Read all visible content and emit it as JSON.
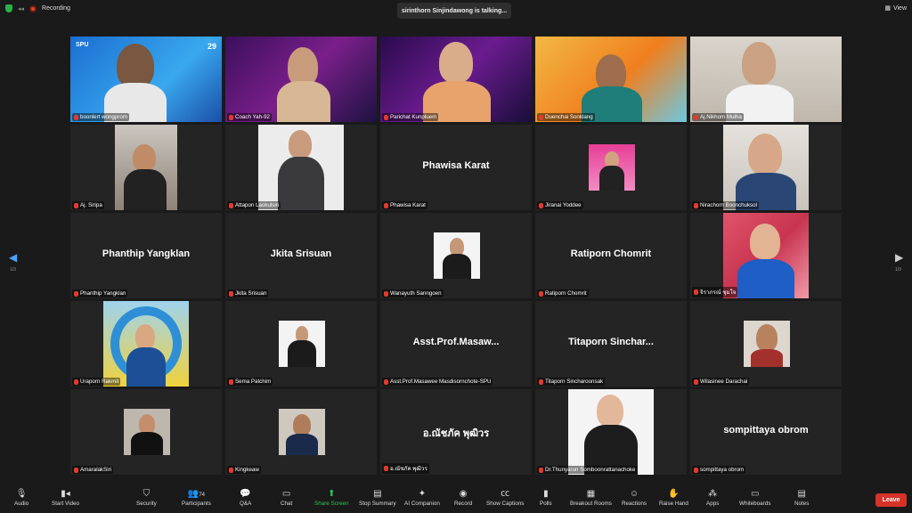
{
  "topbar": {
    "recording_label": "Recording",
    "talking_text": "sirinthorn Sinjindawong is talking...",
    "view_label": "View"
  },
  "navigation": {
    "left_page": "1/3",
    "right_page": "1/3"
  },
  "tiles": [
    {
      "label": "boonlert wongprom",
      "big": ""
    },
    {
      "label": "Coach Yah-92",
      "big": ""
    },
    {
      "label": "Parichat Kunpluem",
      "big": ""
    },
    {
      "label": "Duenchai Sonklang",
      "big": ""
    },
    {
      "label": "Aj.Nikhom Mulha",
      "big": ""
    },
    {
      "label": "Aj. Siripa",
      "big": ""
    },
    {
      "label": "Attapon Laokulsiri",
      "big": ""
    },
    {
      "label": "Phawisa Karat",
      "big": "Phawisa Karat"
    },
    {
      "label": "Jiranai Yoddee",
      "big": ""
    },
    {
      "label": "Nirachorn Boonchuksol",
      "big": ""
    },
    {
      "label": "Phanthip Yangklan",
      "big": "Phanthip Yangklan"
    },
    {
      "label": "Jkita Srisuan",
      "big": "Jkita Srisuan"
    },
    {
      "label": "Wanayuth Sanngoen",
      "big": ""
    },
    {
      "label": "Ratiporn Chomrit",
      "big": "Ratiporn Chomrit"
    },
    {
      "label": "จิราภรณ์ ชุมใจ",
      "big": ""
    },
    {
      "label": "Uraporn Rakmit",
      "big": ""
    },
    {
      "label": "Sema Patchim",
      "big": ""
    },
    {
      "label": "Asst.Prof.Masawee Masdisornchote-SPU",
      "big": "Asst.Prof.Masaw..."
    },
    {
      "label": "Titaporn Sincharoonsak",
      "big": "Titaporn  Sinchar..."
    },
    {
      "label": "Wilasinee Darachai",
      "big": ""
    },
    {
      "label": "AmaralakSiri",
      "big": ""
    },
    {
      "label": "Kingkeaw",
      "big": ""
    },
    {
      "label": "อ.ณัชภัค พุฒิวร",
      "big": "อ.ณัชภัค พุฒิวร"
    },
    {
      "label": "Dr.Thunyarun Somboonrattanachoke",
      "big": ""
    },
    {
      "label": "sompittaya obrom",
      "big": "sompittaya obrom"
    }
  ],
  "toolbar": {
    "audio": "Audio",
    "start_video": "Start Video",
    "security": "Security",
    "participants": "Participants",
    "participants_count": "74",
    "qa": "Q&A",
    "chat": "Chat",
    "share_screen": "Share Screen",
    "stop_summary": "Stop Summary",
    "ai_companion": "AI Companion",
    "record": "Record",
    "show_captions": "Show Captions",
    "polls": "Polls",
    "breakout_rooms": "Breakout Rooms",
    "reactions": "Reactions",
    "raise_hand": "Raise Hand",
    "apps": "Apps",
    "whiteboards": "Whiteboards",
    "notes": "Notes",
    "leave": "Leave"
  },
  "colors": {
    "background": "#1a1a1a",
    "tile": "#242424",
    "leave": "#d63328",
    "share_green": "#2fc35b",
    "mute_red": "#e23a2e"
  }
}
